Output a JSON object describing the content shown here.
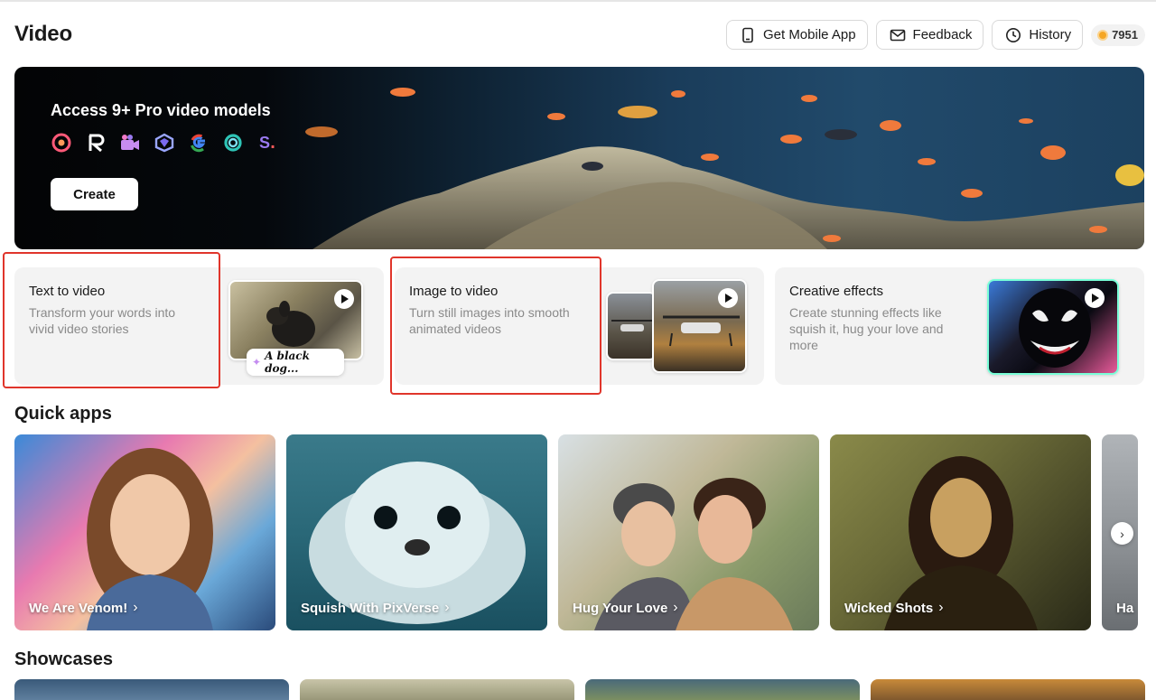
{
  "page": {
    "title": "Video"
  },
  "header": {
    "mobile_app": "Get Mobile App",
    "feedback": "Feedback",
    "history": "History",
    "credits": "7951"
  },
  "hero": {
    "title": "Access 9+ Pro video models",
    "create_label": "Create",
    "model_icons": [
      "pika-icon",
      "runway-icon",
      "kling-icon",
      "luma-icon",
      "google-veo-icon",
      "hailuo-icon",
      "seedance-icon"
    ]
  },
  "features": [
    {
      "title": "Text to video",
      "description": "Transform your words into vivid video stories",
      "prompt_chip": "A black dog..."
    },
    {
      "title": "Image to video",
      "description": "Turn still images into smooth animated videos"
    },
    {
      "title": "Creative effects",
      "description": "Create stunning effects like squish it, hug your love and more"
    }
  ],
  "quick_apps": {
    "title": "Quick apps",
    "items": [
      {
        "label": "We Are Venom!"
      },
      {
        "label": "Squish With PixVerse"
      },
      {
        "label": "Hug Your Love"
      },
      {
        "label": "Wicked Shots"
      },
      {
        "label": "Ha"
      }
    ]
  },
  "showcases": {
    "title": "Showcases"
  },
  "colors": {
    "highlight": "#e0352b",
    "coin": "#f5a623",
    "card_bg": "#f3f3f3"
  }
}
